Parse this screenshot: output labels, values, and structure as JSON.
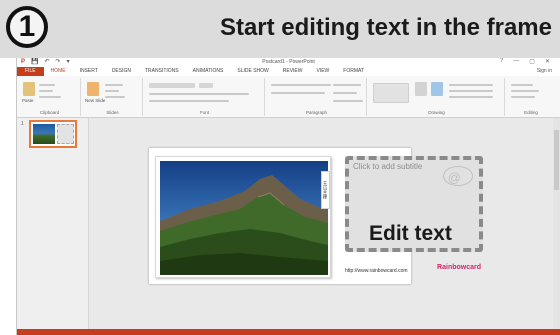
{
  "banner": {
    "step_number": "1",
    "title": "Start editing text in the frame"
  },
  "app": {
    "window_title": "Postcard1 - PowerPoint",
    "quick_access": [
      "P",
      "💾",
      "↶",
      "↷",
      "▾"
    ],
    "window_controls": [
      "?",
      "—",
      "▢",
      "✕"
    ],
    "sign_in": "Sign in"
  },
  "tabs": [
    {
      "label": "FILE"
    },
    {
      "label": "HOME"
    },
    {
      "label": "INSERT"
    },
    {
      "label": "DESIGN"
    },
    {
      "label": "TRANSITIONS"
    },
    {
      "label": "ANIMATIONS"
    },
    {
      "label": "SLIDE SHOW"
    },
    {
      "label": "REVIEW"
    },
    {
      "label": "VIEW"
    },
    {
      "label": "FORMAT"
    }
  ],
  "ribbon": {
    "groups": [
      {
        "name": "Clipboard"
      },
      {
        "name": "Slides"
      },
      {
        "name": "Font"
      },
      {
        "name": "Paragraph"
      },
      {
        "name": "Drawing"
      },
      {
        "name": "Editing"
      }
    ],
    "paste_label": "Paste",
    "new_slide_label": "New Slide"
  },
  "thumbnails": {
    "slide_number": "1"
  },
  "slide": {
    "subtitle_placeholder": "Click to add subtitle",
    "edit_text": "Edit text",
    "footer_url": "http://www.rainbowcard.com",
    "brand": "Rainbowcard"
  },
  "colors": {
    "accent": "#c43e1c",
    "banner_bg": "#dcdcdc",
    "brand": "#d6246e"
  }
}
